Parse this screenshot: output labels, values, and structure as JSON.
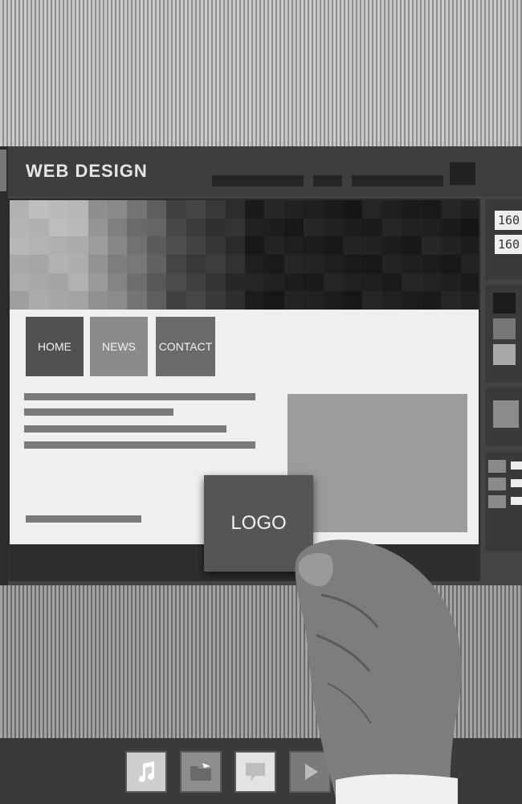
{
  "window": {
    "title": "WEB DESIGN"
  },
  "nav": [
    {
      "label": "HOME",
      "color": "#505050"
    },
    {
      "label": "NEWS",
      "color": "#8a8a8a"
    },
    {
      "label": "CONTACT",
      "color": "#6a6a6a"
    }
  ],
  "logo": {
    "label": "LOGO"
  },
  "side_panel": {
    "values": [
      "160",
      "160"
    ]
  },
  "dock": {
    "icons": [
      "music-icon",
      "folder-icon",
      "chat-icon",
      "play-icon"
    ]
  },
  "colors": {
    "frame": "#444444",
    "canvas": "#efefef",
    "accent_dark": "#2e2e2e"
  }
}
